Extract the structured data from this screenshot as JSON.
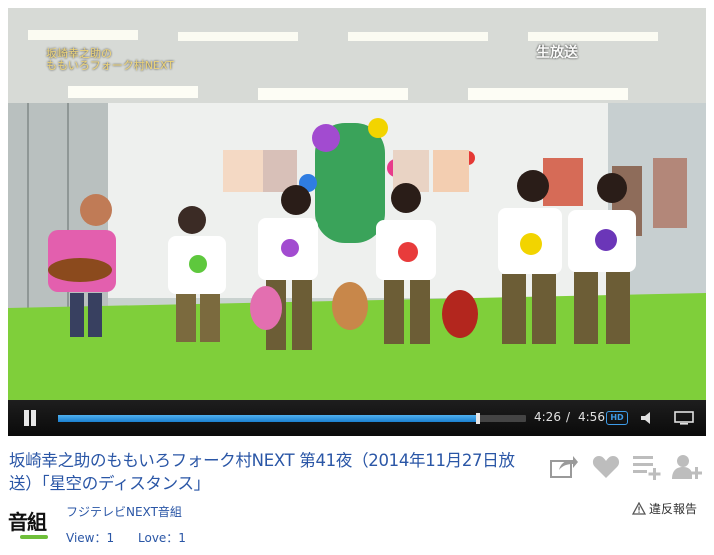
{
  "player": {
    "overlay_top_left": "坂崎幸之助の\nももいろフォーク村NEXT",
    "overlay_live": "生放送",
    "current_time": "4:26",
    "separator": "/",
    "duration": "4:56",
    "progress_fraction": 0.898,
    "hd_label": "HD"
  },
  "video": {
    "title": "坂崎幸之助のももいろフォーク村NEXT 第41夜（2014年11月27日放送）「星空のディスタンス」"
  },
  "channel": {
    "name": "フジテレビNEXT音組",
    "logo_text": "音組",
    "view_label": "View：1",
    "love_label": "Love：1"
  },
  "actions": {
    "report_label": "違反報告"
  },
  "colors": {
    "link": "#2a56a6",
    "progress": "#2f95e6",
    "floor": "#7fcf3a"
  },
  "icons": [
    "play-pause-icon",
    "hd-icon",
    "volume-icon",
    "fullscreen-icon",
    "share-icon",
    "heart-icon",
    "playlist-add-icon",
    "follow-icon",
    "warning-icon"
  ]
}
